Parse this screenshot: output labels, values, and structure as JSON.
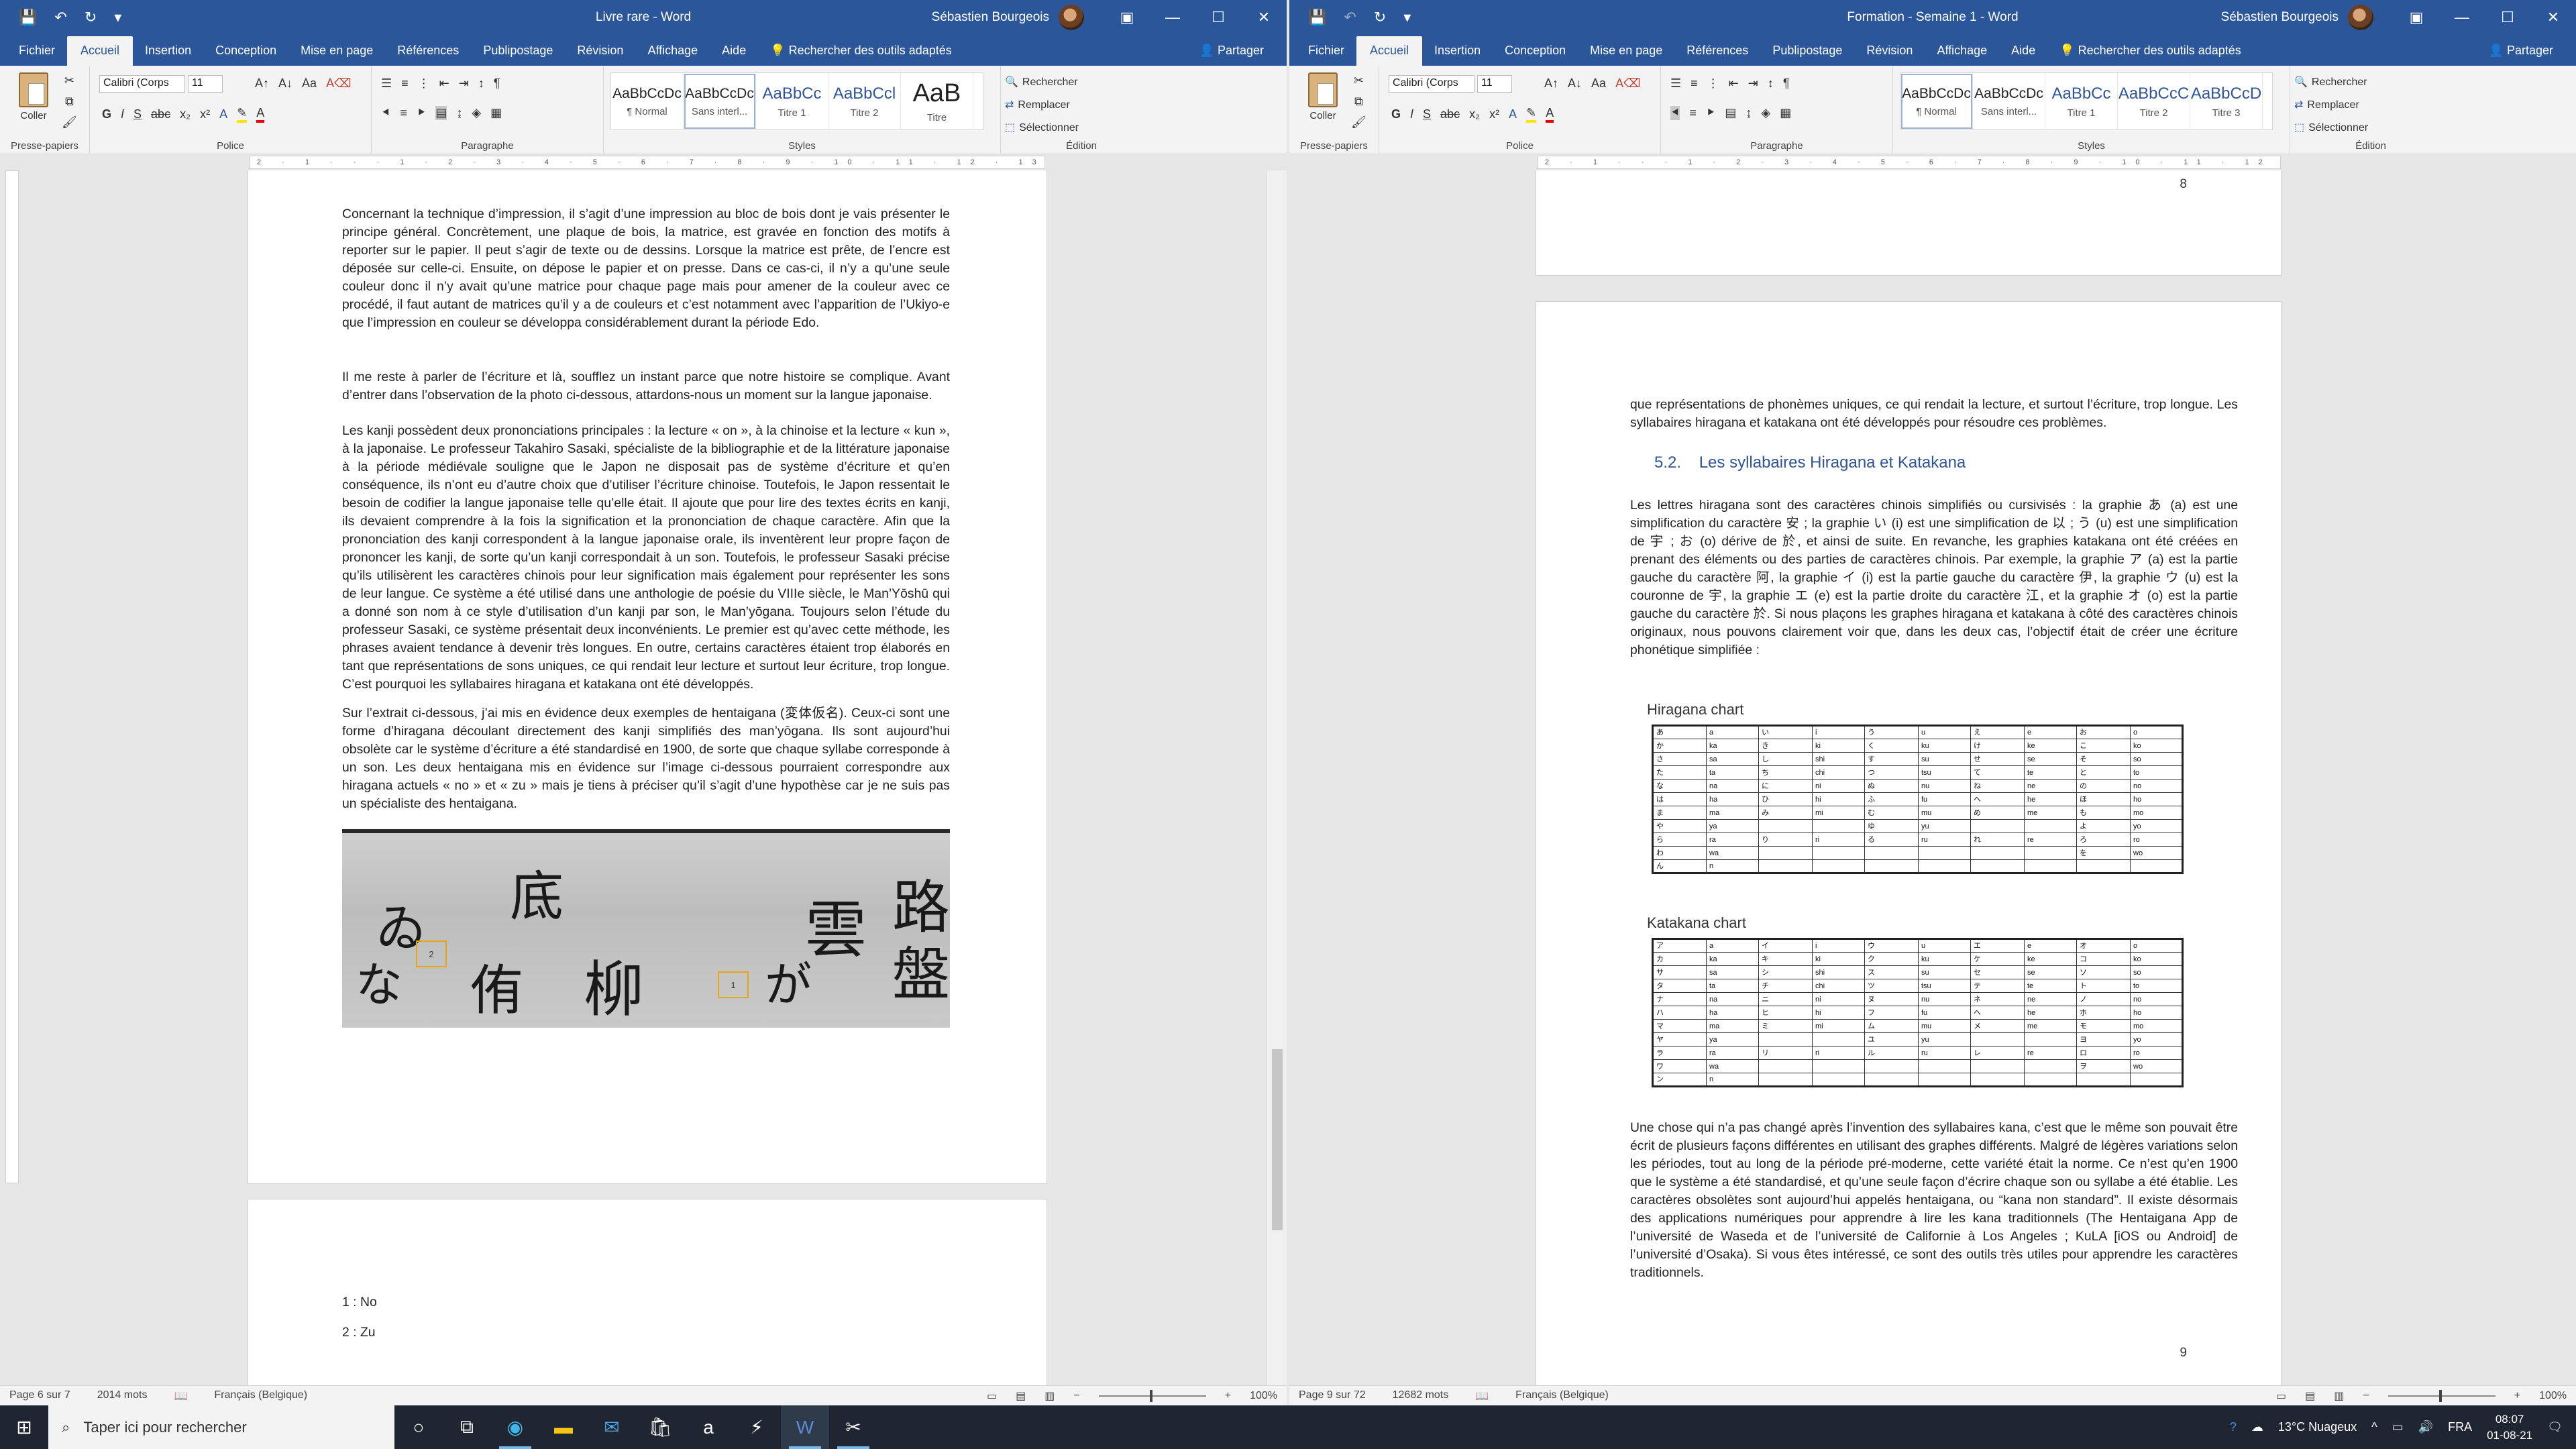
{
  "left": {
    "title": "Livre rare  -  Word",
    "user": "Sébastien Bourgeois",
    "tabs": [
      "Fichier",
      "Accueil",
      "Insertion",
      "Conception",
      "Mise en page",
      "Références",
      "Publipostage",
      "Révision",
      "Affichage",
      "Aide"
    ],
    "tell_me": "Rechercher des outils adaptés",
    "share": "Partager",
    "font_name": "Calibri (Corps",
    "font_size": "11",
    "paste": "Coller",
    "groups": [
      "Presse-papiers",
      "Police",
      "Paragraphe",
      "Styles",
      "Édition"
    ],
    "styles": [
      {
        "preview": "AaBbCcDc",
        "name": "¶ Normal"
      },
      {
        "preview": "AaBbCcDc",
        "name": "Sans interl..."
      },
      {
        "preview": "AaBbCc",
        "name": "Titre 1"
      },
      {
        "preview": "AaBbCcl",
        "name": "Titre 2"
      },
      {
        "preview": "AaB",
        "name": "Titre"
      }
    ],
    "edit": {
      "find": "Rechercher",
      "replace": "Remplacer",
      "select": "Sélectionner"
    },
    "ruler": "2 · 1 · · · 1 · 2 · 3 · 4 · 5 · 6 · 7 · 8 · 9 · 10 · 11 · 12 · 13 · 14 · 15 · 16 · 18",
    "paragraphs": [
      "Concernant la technique d’impression, il s’agit d’une impression au bloc de bois dont je vais présenter le principe général. Concrètement, une plaque de bois, la matrice, est gravée en fonction des motifs à reporter sur le papier. Il peut s’agir de texte ou de dessins. Lorsque la matrice est prête, de l’encre est déposée sur celle-ci. Ensuite, on dépose le papier et on presse. Dans ce cas-ci, il n’y a qu’une seule couleur donc il n’y avait qu’une matrice pour chaque page mais pour amener de la couleur avec ce procédé, il faut autant de matrices qu’il y a de couleurs et c’est notamment avec l’apparition de l’Ukiyo-e que l’impression en couleur se développa considérablement durant la période Edo.",
      "Il me reste à parler de l’écriture et là, soufflez un instant parce que notre histoire se complique. Avant d’entrer dans l’observation de la photo ci-dessous, attardons-nous un moment sur la langue japonaise.",
      "Les kanji possèdent deux prononciations principales : la lecture « on », à la chinoise et la lecture « kun », à la japonaise. Le professeur Takahiro Sasaki, spécialiste de la bibliographie et de la littérature japonaise à la période médiévale souligne que le Japon ne disposait pas de système d’écriture et qu’en conséquence, ils n’ont eu d’autre choix que d’utiliser l’écriture chinoise. Toutefois, le Japon ressentait le besoin de codifier la langue japonaise telle qu’elle était. Il ajoute que pour lire des textes écrits en kanji, ils devaient comprendre à la fois la signification et la prononciation de chaque caractère. Afin que la prononciation des kanji correspondent à la langue japonaise orale, ils inventèrent leur propre façon de prononcer les kanji, de sorte qu’un kanji correspondait à un son. Toutefois, le professeur Sasaki précise qu’ils utilisèrent les caractères chinois pour leur signification mais également pour représenter les sons de leur langue. Ce système a été utilisé dans une anthologie de poésie du VIIIe siècle, le Man’Yōshū qui a donné son nom à ce style d’utilisation d’un kanji par son, le Man’yōgana. Toujours selon l’étude du professeur Sasaki, ce système présentait deux inconvénients. Le premier est qu’avec cette méthode, les phrases avaient tendance à devenir très longues. En outre, certains caractères étaient trop élaborés en tant que représentations de sons uniques, ce qui rendait leur lecture et surtout leur écriture, trop longue. C’est pourquoi les syllabaires hiragana et katakana ont été développés.",
      "Sur l’extrait ci-dessous, j’ai mis en évidence deux exemples de hentaigana (変体仮名). Ceux-ci sont une forme d’hiragana découlant directement des kanji simplifiés des man’yōgana. Ils sont aujourd’hui obsolète car le système d’écriture a été standardisé en 1900, de sorte que chaque syllabe corresponde à un son. Les deux hentaigana mis en évidence sur l’image ci-dessous pourraient correspondre aux hiragana actuels « no » et « zu » mais je tiens à préciser qu’il s’agit d’une hypothèse car je ne suis pas un spécialiste des hentaigana."
    ],
    "photo_chars": [
      "路",
      "盤",
      "雲",
      "が",
      "柳",
      "侑",
      "底",
      "ゐ",
      "な"
    ],
    "markers": [
      "2",
      "1"
    ],
    "footnotes": [
      "1 : No",
      "2 : Zu"
    ],
    "status": {
      "page": "Page 6 sur 7",
      "words": "2014 mots",
      "lang": "Français (Belgique)",
      "zoom": "100%"
    }
  },
  "right": {
    "title": "Formation - Semaine 1  -  Word",
    "user": "Sébastien Bourgeois",
    "tabs": [
      "Fichier",
      "Accueil",
      "Insertion",
      "Conception",
      "Mise en page",
      "Références",
      "Publipostage",
      "Révision",
      "Affichage",
      "Aide"
    ],
    "tell_me": "Rechercher des outils adaptés",
    "share": "Partager",
    "font_name": "Calibri (Corps",
    "font_size": "11",
    "paste": "Coller",
    "groups": [
      "Presse-papiers",
      "Police",
      "Paragraphe",
      "Styles",
      "Édition"
    ],
    "styles": [
      {
        "preview": "AaBbCcDc",
        "name": "¶ Normal"
      },
      {
        "preview": "AaBbCcDc",
        "name": "Sans interl..."
      },
      {
        "preview": "AaBbCc",
        "name": "Titre 1"
      },
      {
        "preview": "AaBbCcC",
        "name": "Titre 2"
      },
      {
        "preview": "AaBbCcD",
        "name": "Titre 3"
      }
    ],
    "edit": {
      "find": "Rechercher",
      "replace": "Remplacer",
      "select": "Sélectionner"
    },
    "ruler": "2 · 1 · · · 1 · 2 · 3 · 4 · 5 · 6 · 7 · 8 · 9 · 10 · 11 · 12 · 13 · 14 · 15 · 16 · 18",
    "page_top_num": "8",
    "para_intro": "que représentations de phonèmes uniques, ce qui rendait la lecture, et surtout l’écriture, trop longue. Les syllabaires hiragana et katakana ont été développés pour résoudre ces problèmes.",
    "heading_num": "5.2.",
    "heading": "Les syllabaires Hiragana et Katakana",
    "para2": "Les lettres hiragana sont des caractères chinois simplifiés ou cursivisés : la graphie あ (a) est une simplification du caractère 安 ; la graphie い (i) est une simplification de 以 ; う (u) est une simplification de 宇 ; お (o) dérive de 於, et ainsi de suite. En revanche, les graphies katakana ont été créées en prenant des éléments ou des parties de caractères chinois. Par exemple, la graphie ア (a) est la partie gauche du caractère 阿, la graphie イ (i) est la partie gauche du caractère 伊, la graphie ウ (u) est la couronne de 宇, la graphie エ (e) est la partie droite du caractère 江, et la graphie オ (o) est la partie gauche du caractère 於. Si nous plaçons les graphes hiragana et katakana à côté des caractères chinois originaux, nous pouvons clairement voir que, dans les deux cas, l’objectif était de créer une écriture phonétique simplifiée :",
    "hira_title": "Hiragana chart",
    "kata_title": "Katakana chart",
    "hiragana": [
      [
        "あ",
        "a",
        "い",
        "i",
        "う",
        "u",
        "え",
        "e",
        "お",
        "o"
      ],
      [
        "か",
        "ka",
        "き",
        "ki",
        "く",
        "ku",
        "け",
        "ke",
        "こ",
        "ko"
      ],
      [
        "さ",
        "sa",
        "し",
        "shi",
        "す",
        "su",
        "せ",
        "se",
        "そ",
        "so"
      ],
      [
        "た",
        "ta",
        "ち",
        "chi",
        "つ",
        "tsu",
        "て",
        "te",
        "と",
        "to"
      ],
      [
        "な",
        "na",
        "に",
        "ni",
        "ぬ",
        "nu",
        "ね",
        "ne",
        "の",
        "no"
      ],
      [
        "は",
        "ha",
        "ひ",
        "hi",
        "ふ",
        "fu",
        "へ",
        "he",
        "ほ",
        "ho"
      ],
      [
        "ま",
        "ma",
        "み",
        "mi",
        "む",
        "mu",
        "め",
        "me",
        "も",
        "mo"
      ],
      [
        "や",
        "ya",
        "",
        "",
        "ゆ",
        "yu",
        "",
        "",
        "よ",
        "yo"
      ],
      [
        "ら",
        "ra",
        "り",
        "ri",
        "る",
        "ru",
        "れ",
        "re",
        "ろ",
        "ro"
      ],
      [
        "わ",
        "wa",
        "",
        "",
        "",
        "",
        "",
        "",
        "を",
        "wo"
      ],
      [
        "ん",
        "n",
        "",
        "",
        "",
        "",
        "",
        "",
        "",
        ""
      ]
    ],
    "katakana": [
      [
        "ア",
        "a",
        "イ",
        "i",
        "ウ",
        "u",
        "エ",
        "e",
        "オ",
        "o"
      ],
      [
        "カ",
        "ka",
        "キ",
        "ki",
        "ク",
        "ku",
        "ケ",
        "ke",
        "コ",
        "ko"
      ],
      [
        "サ",
        "sa",
        "シ",
        "shi",
        "ス",
        "su",
        "セ",
        "se",
        "ソ",
        "so"
      ],
      [
        "タ",
        "ta",
        "チ",
        "chi",
        "ツ",
        "tsu",
        "テ",
        "te",
        "ト",
        "to"
      ],
      [
        "ナ",
        "na",
        "ニ",
        "ni",
        "ヌ",
        "nu",
        "ネ",
        "ne",
        "ノ",
        "no"
      ],
      [
        "ハ",
        "ha",
        "ヒ",
        "hi",
        "フ",
        "fu",
        "ヘ",
        "he",
        "ホ",
        "ho"
      ],
      [
        "マ",
        "ma",
        "ミ",
        "mi",
        "ム",
        "mu",
        "メ",
        "me",
        "モ",
        "mo"
      ],
      [
        "ヤ",
        "ya",
        "",
        "",
        "ユ",
        "yu",
        "",
        "",
        "ヨ",
        "yo"
      ],
      [
        "ラ",
        "ra",
        "リ",
        "ri",
        "ル",
        "ru",
        "レ",
        "re",
        "ロ",
        "ro"
      ],
      [
        "ワ",
        "wa",
        "",
        "",
        "",
        "",
        "",
        "",
        "ヲ",
        "wo"
      ],
      [
        "ン",
        "n",
        "",
        "",
        "",
        "",
        "",
        "",
        "",
        ""
      ]
    ],
    "para3": "Une chose qui n’a pas changé après l’invention des syllabaires kana, c’est que le même son pouvait être écrit de plusieurs façons différentes en utilisant des graphes différents. Malgré de légères variations selon les périodes, tout au long de la période pré-moderne, cette variété était la norme. Ce n’est qu’en 1900 que le système a été standardisé, et qu’une seule façon d’écrire chaque son ou syllabe a été établie. Les caractères obsolètes sont aujourd’hui appelés hentaigana, ou “kana non standard”. Il existe désormais des applications numériques pour apprendre à lire les kana traditionnels (The Hentaigana App de l’université de Waseda et de l’université de Californie à Los Angeles ; KuLA [iOS ou Android] de l’université d’Osaka). Si vous êtes intéressé, ce sont des outils très utiles pour apprendre les caractères traditionnels.",
    "page_bottom_num": "9",
    "status": {
      "page": "Page 9 sur 72",
      "words": "12682 mots",
      "lang": "Français (Belgique)",
      "zoom": "100%"
    }
  },
  "taskbar": {
    "search_placeholder": "Taper ici pour rechercher",
    "weather": "13°C  Nuageux",
    "lang": "FRA",
    "time": "08:07",
    "date": "01-08-21",
    "apps": [
      "task-view",
      "edge",
      "file-explorer",
      "mail",
      "store",
      "amazon",
      "winamp-like",
      "word",
      "snip"
    ]
  },
  "colors": {
    "titlebar": "#2b579a",
    "taskbar": "#1f2631",
    "heading": "#2f5597",
    "highlight": "#e6a514"
  }
}
